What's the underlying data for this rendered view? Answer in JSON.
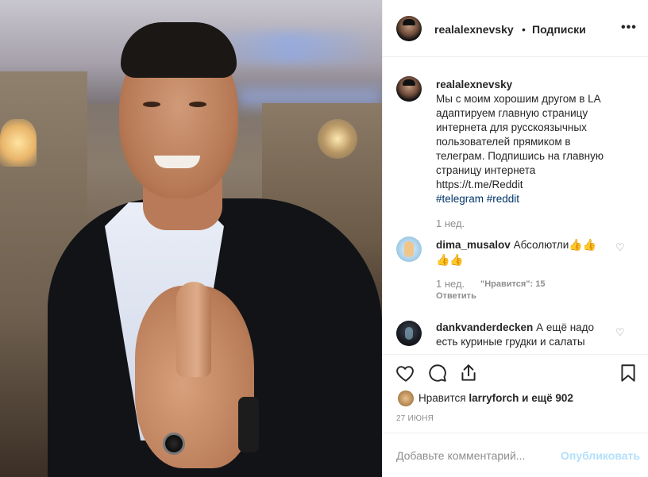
{
  "post": {
    "username": "realalexnevsky",
    "separator": "•",
    "follow_label": "Подписки",
    "more_label": "•••"
  },
  "caption": {
    "username": "realalexnevsky",
    "line1": "Мы с моим хорошим другом в LA",
    "line2": "адаптируем главную страницу",
    "line3": "интернета для русскоязычных",
    "line4": "пользователей прямиком в",
    "line5": "телеграм. Подпишись на главную",
    "line6": "страницу интернета",
    "url": "https://t.me/Reddit",
    "tags": "#telegram #reddit",
    "time": "1 нед."
  },
  "comments": [
    {
      "username": "dima_musalov",
      "text": "Абсолютли",
      "emoji1": "👍👍",
      "emoji2": "👍👍",
      "time": "1 нед.",
      "likes": "\"Нравится\": 15",
      "reply": "Ответить"
    },
    {
      "username": "dankvanderdecken",
      "text": "А ещё надо",
      "text2": "есть куриные грудки и салаты"
    }
  ],
  "likes": {
    "prefix": "Нравится",
    "user": "larryforch",
    "suffix": "и ещё 902"
  },
  "date": "27 ИЮНЯ",
  "add_comment": {
    "placeholder": "Добавьте комментарий...",
    "publish": "Опубликовать"
  },
  "colors": {
    "text": "#262626",
    "muted": "#8e8e8e",
    "hashtag": "#003569",
    "publish_disabled": "#b2dffc",
    "border": "#efefef"
  },
  "icons": [
    "heart-icon",
    "comment-icon",
    "share-icon",
    "bookmark-icon",
    "more-icon",
    "heart-small-icon"
  ]
}
